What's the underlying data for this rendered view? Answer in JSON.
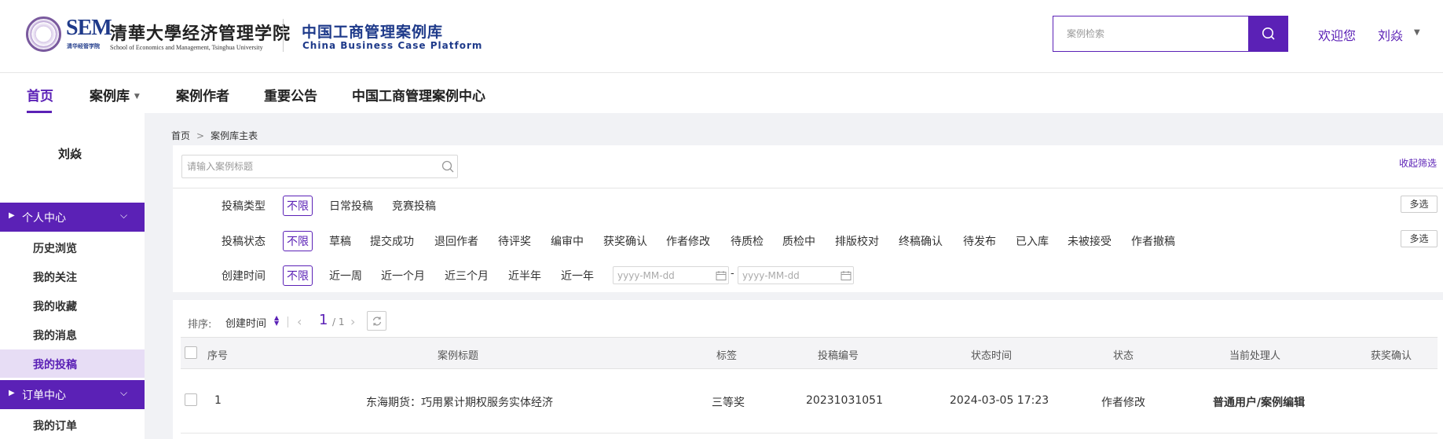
{
  "header": {
    "logo_sem": "SEM",
    "logo_sem_sub": "清华经管学院",
    "logo_cn": "清華大學经济管理学院",
    "logo_en": "School of Economics and Management, Tsinghua University",
    "platform_cn": "中国工商管理案例库",
    "platform_en": "China Business Case Platform",
    "search_placeholder": "案例检索",
    "welcome": "欢迎您",
    "username": "刘焱",
    "accent_color": "#5b21b6"
  },
  "nav": {
    "items": [
      "首页",
      "案例库",
      "案例作者",
      "重要公告",
      "中国工商管理案例中心"
    ],
    "active": "首页"
  },
  "sidebar": {
    "user": "刘焱",
    "sections": [
      {
        "label": "个人中心",
        "items": [
          "历史浏览",
          "我的关注",
          "我的收藏",
          "我的消息",
          "我的投稿"
        ]
      },
      {
        "label": "订单中心",
        "items": [
          "我的订单"
        ]
      }
    ],
    "active_item": "我的投稿"
  },
  "breadcrumb": {
    "home": "首页",
    "current": "案例库主表"
  },
  "filters": {
    "title_placeholder": "请输入案例标题",
    "collapse": "收起筛选",
    "multi": "多选",
    "type": {
      "label": "投稿类型",
      "options": [
        "不限",
        "日常投稿",
        "竞赛投稿"
      ],
      "selected": "不限"
    },
    "status": {
      "label": "投稿状态",
      "options": [
        "不限",
        "草稿",
        "提交成功",
        "退回作者",
        "待评奖",
        "编审中",
        "获奖确认",
        "作者修改",
        "待质检",
        "质检中",
        "排版校对",
        "终稿确认",
        "待发布",
        "已入库",
        "未被接受",
        "作者撤稿"
      ],
      "selected": "不限"
    },
    "created": {
      "label": "创建时间",
      "options": [
        "不限",
        "近一周",
        "近一个月",
        "近三个月",
        "近半年",
        "近一年"
      ],
      "selected": "不限"
    },
    "date_placeholder": "yyyy-MM-dd",
    "date_dash": "-"
  },
  "list": {
    "sort_label": "排序:",
    "sort_value": "创建时间",
    "page_current": "1",
    "page_total": "/ 1",
    "columns": [
      "序号",
      "案例标题",
      "标签",
      "投稿编号",
      "状态时间",
      "状态",
      "当前处理人",
      "获奖确认"
    ],
    "rows": [
      {
        "index": "1",
        "title": "东海期货：巧用累计期权服务实体经济",
        "tag": "三等奖",
        "number": "20231031051",
        "time": "2024-03-05 17:23",
        "status": "作者修改",
        "handler": "普通用户/案例编辑",
        "award": ""
      }
    ]
  }
}
